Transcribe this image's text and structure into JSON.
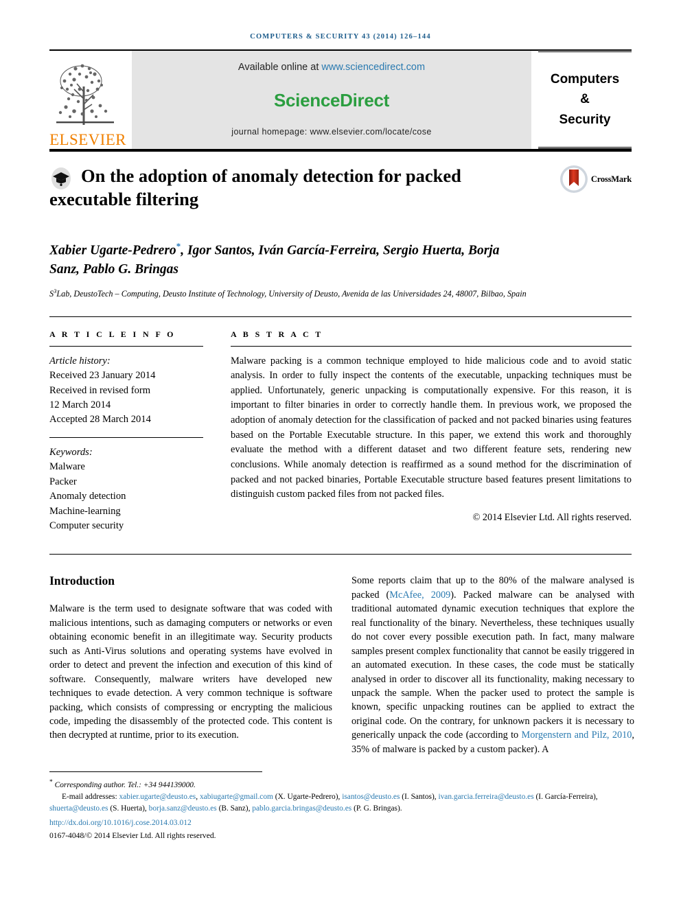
{
  "running_head": "COMPUTERS & SECURITY 43 (2014) 126–144",
  "masthead": {
    "publisher_logo_label": "ELSEVIER",
    "available_prefix": "Available online at ",
    "available_link": "www.sciencedirect.com",
    "sciencedirect_logo": "ScienceDirect",
    "journal_homepage": "journal homepage: www.elsevier.com/locate/cose",
    "journal_title_lines": [
      "Computers",
      "&",
      "Security"
    ],
    "colors": {
      "elsevier_orange": "#F08000",
      "sciencedirect_green": "#2b9e40",
      "link_blue": "#2a7ab0",
      "running_head_blue": "#1a5a8a",
      "band_gray": "#e4e4e4"
    }
  },
  "article": {
    "title": "On the adoption of anomaly detection for packed executable filtering",
    "crossmark_label": "CrossMark",
    "authors": "Xabier Ugarte-Pedrero",
    "authors_full": "Xabier Ugarte-Pedrero*, Igor Santos, Iván García-Ferreira, Sergio Huerta, Borja Sanz, Pablo G. Bringas",
    "author_star": "*",
    "authors_rest": ", Igor Santos, Iván García-Ferreira, Sergio Huerta, Borja Sanz, Pablo G. Bringas",
    "affiliation_sup": "3",
    "affiliation_pre": "S",
    "affiliation": "Lab, DeustoTech – Computing, Deusto Institute of Technology, University of Deusto, Avenida de las Universidades 24, 48007, Bilbao, Spain"
  },
  "article_info": {
    "heading": "A R T I C L E   I N F O",
    "history_label": "Article history:",
    "history": [
      "Received 23 January 2014",
      "Received in revised form",
      "12 March 2014",
      "Accepted 28 March 2014"
    ],
    "keywords_label": "Keywords:",
    "keywords": [
      "Malware",
      "Packer",
      "Anomaly detection",
      "Machine-learning",
      "Computer security"
    ]
  },
  "abstract": {
    "heading": "A B S T R A C T",
    "text": "Malware packing is a common technique employed to hide malicious code and to avoid static analysis. In order to fully inspect the contents of the executable, unpacking techniques must be applied. Unfortunately, generic unpacking is computationally expensive. For this reason, it is important to filter binaries in order to correctly handle them. In previous work, we proposed the adoption of anomaly detection for the classification of packed and not packed binaries using features based on the Portable Executable structure. In this paper, we extend this work and thoroughly evaluate the method with a different dataset and two different feature sets, rendering new conclusions. While anomaly detection is reaffirmed as a sound method for the discrimination of packed and not packed binaries, Portable Executable structure based features present limitations to distinguish custom packed files from not packed files.",
    "copyright": "© 2014 Elsevier Ltd. All rights reserved."
  },
  "introduction": {
    "heading": "Introduction",
    "left_paragraph": "Malware is the term used to designate software that was coded with malicious intentions, such as damaging computers or networks or even obtaining economic benefit in an illegitimate way. Security products such as Anti-Virus solutions and operating systems have evolved in order to detect and prevent the infection and execution of this kind of software. Consequently, malware writers have developed new techniques to evade detection. A very common technique is software packing, which consists of compressing or encrypting the malicious code, impeding the disassembly of the protected code. This content is then decrypted at runtime, prior to its execution.",
    "right_part1": "Some reports claim that up to the 80% of the malware analysed is packed (",
    "right_cite1": "McAfee, 2009",
    "right_part2": "). Packed malware can be analysed with traditional automated dynamic execution techniques that explore the real functionality of the binary. Nevertheless, these techniques usually do not cover every possible execution path. In fact, many malware samples present complex functionality that cannot be easily triggered in an automated execution. In these cases, the code must be statically analysed in order to discover all its functionality, making necessary to unpack the sample. When the packer used to protect the sample is known, specific unpacking routines can be applied to extract the original code. On the contrary, for unknown packers it is necessary to generically unpack the code (according to ",
    "right_cite2": "Morgenstern and Pilz, 2010",
    "right_part3": ", 35% of malware is packed by a custom packer). A"
  },
  "footer": {
    "corresponding_star": "*",
    "corresponding": "Corresponding author. Tel.: +34 944139000.",
    "email_label": "E-mail addresses:",
    "emails": [
      {
        "address": "xabier.ugarte@deusto.es",
        "sep": ", "
      },
      {
        "address": "xabiugarte@gmail.com",
        "sep": " "
      },
      {
        "name": "(X. Ugarte-Pedrero), "
      },
      {
        "address": "isantos@deusto.es",
        "sep": " "
      },
      {
        "name": "(I. Santos), "
      },
      {
        "address": "ivan.garcia.ferreira@deusto.es",
        "sep": " "
      },
      {
        "name": "(I. García-Ferreira), "
      },
      {
        "address": "shuerta@deusto.es",
        "sep": " "
      },
      {
        "name": "(S. Huerta), "
      },
      {
        "address": "borja.sanz@deusto.es",
        "sep": " "
      },
      {
        "name": "(B. Sanz), "
      },
      {
        "address": "pablo.garcia.bringas@deusto.es",
        "sep": " "
      },
      {
        "name": "(P. G. Bringas)."
      }
    ],
    "doi": "http://dx.doi.org/10.1016/j.cose.2014.03.012",
    "issn": "0167-4048/© 2014 Elsevier Ltd. All rights reserved."
  }
}
